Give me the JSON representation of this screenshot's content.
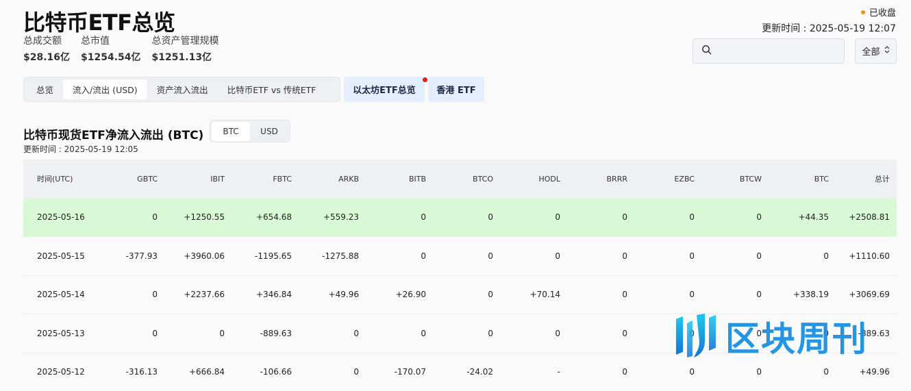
{
  "header": {
    "title": "比特币ETF总览",
    "stats": [
      {
        "label": "总成交额",
        "value": "$28.16亿"
      },
      {
        "label": "总市值",
        "value": "$1254.54亿"
      },
      {
        "label": "总资产管理规模",
        "value": "$1251.13亿"
      }
    ],
    "market_status": "已收盘",
    "updated": "更新时间 : 2025-05-19 12:07"
  },
  "search": {
    "placeholder": ""
  },
  "filter": {
    "selected": "全部"
  },
  "tabs": [
    {
      "label": "总览",
      "active": false
    },
    {
      "label": "流入/流出 (USD)",
      "active": true
    },
    {
      "label": "资产流入流出",
      "active": false
    },
    {
      "label": "比特币ETF vs 传统ETF",
      "active": false
    }
  ],
  "links": {
    "eth": "以太坊ETF总览",
    "hk": "香港 ETF"
  },
  "section": {
    "title": "比特币现货ETF净流入流出 (BTC)",
    "units": [
      "BTC",
      "USD"
    ],
    "active_unit": "BTC",
    "updated": "更新时间 : 2025-05-19 12:05"
  },
  "table": {
    "headers": [
      "时间(UTC)",
      "GBTC",
      "IBIT",
      "FBTC",
      "ARKB",
      "BITB",
      "BTCO",
      "HODL",
      "BRRR",
      "EZBC",
      "BTCW",
      "BTC",
      "总计"
    ],
    "rows": [
      [
        "2025-05-16",
        "0",
        "+1250.55",
        "+654.68",
        "+559.23",
        "0",
        "0",
        "0",
        "0",
        "0",
        "0",
        "+44.35",
        "+2508.81"
      ],
      [
        "2025-05-15",
        "-377.93",
        "+3960.06",
        "-1195.65",
        "-1275.88",
        "0",
        "0",
        "0",
        "0",
        "0",
        "0",
        "0",
        "+1110.60"
      ],
      [
        "2025-05-14",
        "0",
        "+2237.66",
        "+346.84",
        "+49.96",
        "+26.90",
        "0",
        "+70.14",
        "0",
        "0",
        "0",
        "+338.19",
        "+3069.69"
      ],
      [
        "2025-05-13",
        "0",
        "0",
        "-889.63",
        "0",
        "0",
        "0",
        "0",
        "0",
        "0",
        "0",
        "0",
        "-889.63"
      ],
      [
        "2025-05-12",
        "-316.13",
        "+666.84",
        "-106.66",
        "0",
        "-170.07",
        "-24.02",
        "-",
        "0",
        "0",
        "0",
        "0",
        "+49.96"
      ]
    ]
  },
  "watermark": {
    "text": "区块周刊"
  },
  "colors": {
    "positive": "#15a06a",
    "negative": "#e84a4a",
    "highlight_row": "#d9f8d5",
    "accent_link_bg": "#e3efff",
    "status_dot": "#f5900d"
  }
}
